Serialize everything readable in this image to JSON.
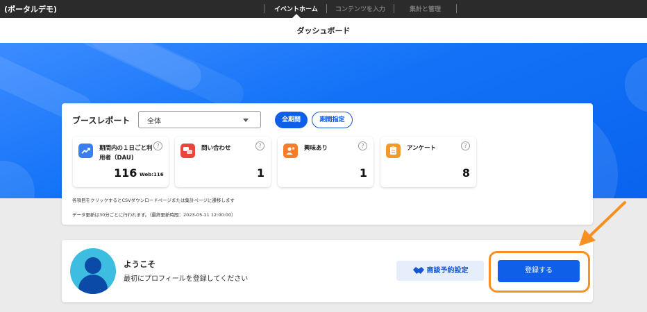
{
  "app": {
    "title": "(ポータルデモ)"
  },
  "nav": {
    "tabs": [
      {
        "label": "イベントホーム",
        "active": true
      },
      {
        "label": "コンテンツを入力",
        "active": false
      },
      {
        "label": "集計と管理",
        "active": false
      }
    ]
  },
  "page": {
    "title": "ダッシュボード"
  },
  "report": {
    "title": "ブースレポート",
    "filter_value": "全体",
    "period_buttons": [
      "全期間",
      "期間指定"
    ],
    "stats": [
      {
        "label": "期間内の１日ごと利用者（DAU)",
        "value": "116",
        "sub": "Web:116",
        "icon": "trend-chart-icon",
        "color": "#3a7df0"
      },
      {
        "label": "問い合わせ",
        "value": "1",
        "icon": "chat-bubbles-icon",
        "color": "#e8453c"
      },
      {
        "label": "興味あり",
        "value": "1",
        "icon": "person-heart-icon",
        "color": "#f47c2a"
      },
      {
        "label": "アンケート",
        "value": "8",
        "icon": "clipboard-icon",
        "color": "#f59a2a"
      }
    ],
    "help_glyph": "?",
    "note_click": "各項目をクリックするとCSVダウンロードページまたは集計ページに遷移します",
    "note_update": "データ更新は30分ごとに行われます。（最終更新時間：2023-05-11 12:00:00）"
  },
  "welcome": {
    "title": "ようこそ",
    "subtitle": "最初にプロフィールを登録してください",
    "meeting_button": "商談予約設定",
    "register_button": "登録する"
  },
  "colors": {
    "primary": "#0f5fe8",
    "highlight": "#f7901e",
    "nav_bg": "#2b2b2b"
  }
}
